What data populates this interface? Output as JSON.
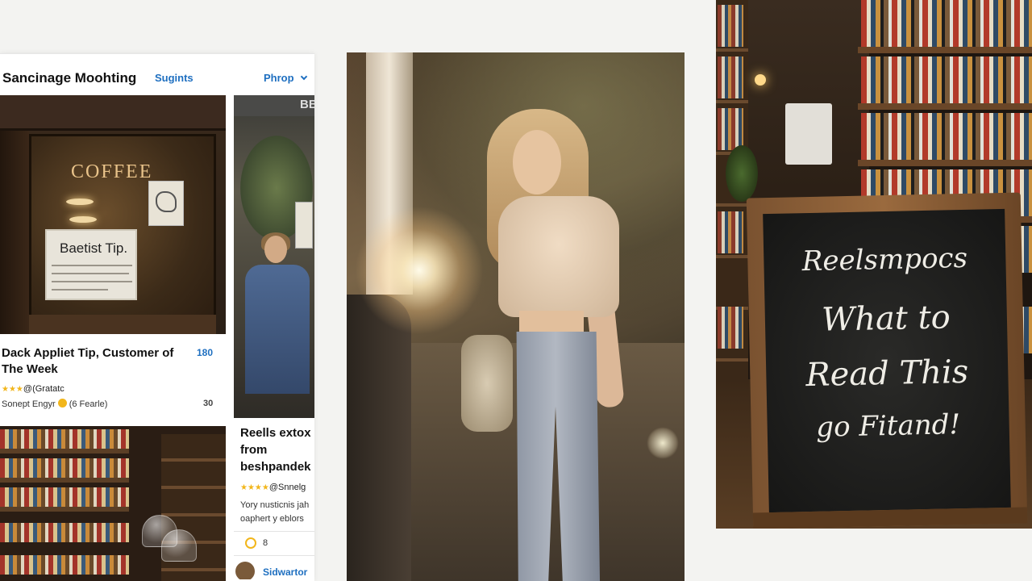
{
  "app": {
    "title": "Sancinage Moohting",
    "nav": [
      {
        "label": "Sugints"
      },
      {
        "label": "Phrop"
      }
    ]
  },
  "cards": {
    "featured": {
      "image_text": {
        "shop_sign": "COFFEE",
        "board_title": "Baetist Tip."
      },
      "title": "Dack Appliet Tip, Customer of The Week",
      "count": "180",
      "stars": "★★★",
      "rating_label": "@(Gratatc",
      "meta_text": "Sonept Engyr",
      "meta_people": "(6 Fearle)",
      "meta_count": "30"
    },
    "secondary": {
      "image_text": "BB",
      "title": "Reells extox from beshpandek",
      "stars": "★★★★",
      "rating_label": "@Snnelg",
      "desc_line1": "Yory nusticnis jah",
      "desc_line2": "oaphert y eblors",
      "icon_count": "8",
      "author": "Sidwartor"
    }
  },
  "chalkboard": {
    "lines": [
      "Reelsmpocs",
      "What to",
      "Read This",
      "go Fitand!"
    ]
  },
  "colors": {
    "accent": "#1e6fc0",
    "star": "#f2b61b",
    "page_bg": "#f3f3f1"
  }
}
